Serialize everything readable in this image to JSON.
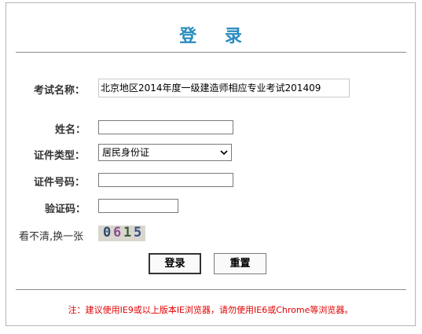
{
  "form": {
    "title": "登 录",
    "exam_name_label": "考试名称：",
    "exam_name_value": "北京地区2014年度一级建造师相应专业考试201409",
    "name_label": "姓名：",
    "name_value": "",
    "id_type_label": "证件类型：",
    "id_type_selected": "居民身份证",
    "id_number_label": "证件号码：",
    "id_number_value": "",
    "captcha_label": "验证码：",
    "captcha_value": "",
    "refresh_captcha_label": "看不清,换一张",
    "captcha_chars": [
      "0",
      "6",
      "1",
      "5"
    ],
    "login_button": "登录",
    "reset_button": "重置"
  },
  "note": "注：建议使用IE9或以上版本IE浏览器，请勿使用IE6或Chrome等浏览器。",
  "colors": {
    "title": "#2a8bbf",
    "note": "#e00000",
    "captcha_chars": [
      "#2b4a6e",
      "#8a4f8f",
      "#3b5f3a",
      "#3a4f86"
    ]
  },
  "icons": {
    "select_arrow": "chevron-down-icon"
  }
}
